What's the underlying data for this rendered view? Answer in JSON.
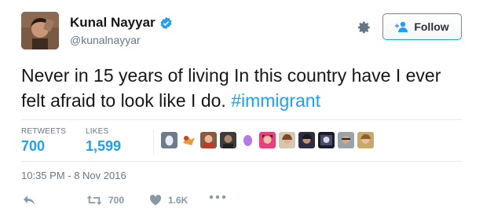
{
  "user": {
    "display_name": "Kunal Nayyar",
    "handle": "@kunalnayyar"
  },
  "follow_label": "Follow",
  "tweet": {
    "text": "Never in 15 years of living In this country have I ever felt afraid to look like I do.",
    "hashtag": "#immigrant"
  },
  "stats": {
    "retweets_label": "RETWEETS",
    "retweets_value": "700",
    "likes_label": "LIKES",
    "likes_value": "1,599"
  },
  "timestamp": "10:35 PM - 8 Nov 2016",
  "actions": {
    "retweet_count": "700",
    "like_count": "1.6K"
  },
  "colors": {
    "accent": "#1da1f2",
    "muted": "#657786"
  }
}
